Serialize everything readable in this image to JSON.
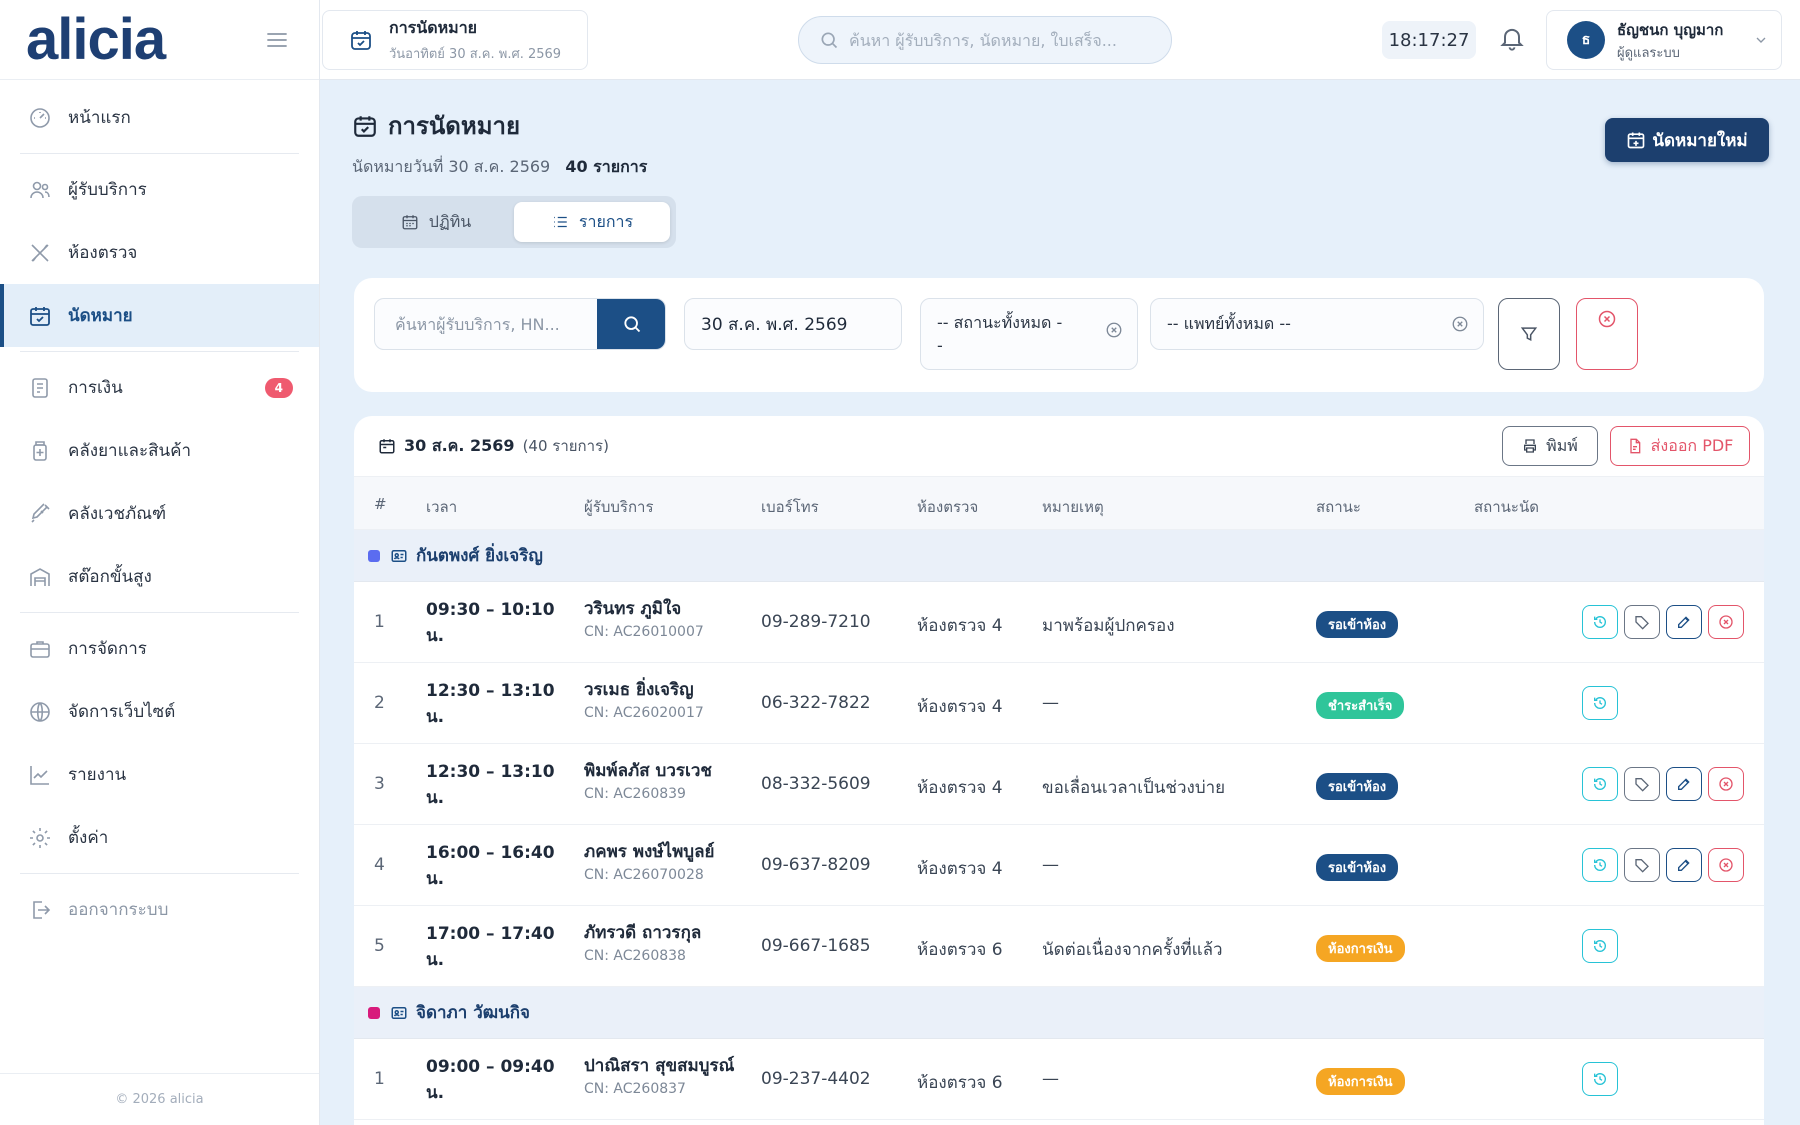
{
  "brand": {
    "logo": "alicia"
  },
  "sidebar": {
    "items": [
      {
        "label": "หน้าแรก",
        "icon": "gauge-icon"
      },
      {
        "label": "ผู้รับบริการ",
        "icon": "users-icon"
      },
      {
        "label": "ห้องตรวจ",
        "icon": "stethoscope-icon"
      },
      {
        "label": "นัดหมาย",
        "icon": "calendar-check-icon",
        "active": true
      },
      {
        "label": "การเงิน",
        "icon": "receipt-icon",
        "badge": "4"
      },
      {
        "label": "คลังยาและสินค้า",
        "icon": "medicine-icon"
      },
      {
        "label": "คลังเวชภัณฑ์",
        "icon": "syringe-icon"
      },
      {
        "label": "สต๊อกขั้นสูง",
        "icon": "warehouse-icon"
      },
      {
        "label": "การจัดการ",
        "icon": "briefcase-icon"
      },
      {
        "label": "จัดการเว็บไซต์",
        "icon": "globe-icon"
      },
      {
        "label": "รายงาน",
        "icon": "chart-line-icon"
      },
      {
        "label": "ตั้งค่า",
        "icon": "gear-icon"
      },
      {
        "label": "ออกจากระบบ",
        "icon": "logout-icon"
      }
    ],
    "footer": "© 2026 alicia"
  },
  "topbar": {
    "crumb_title": "การนัดหมาย",
    "crumb_sub": "วันอาทิตย์ 30 ส.ค. พ.ศ. 2569",
    "search_placeholder": "ค้นหา ผู้รับบริการ, นัดหมาย, ใบเสร็จ...",
    "clock": "18:17:27",
    "user_initial": "ธ",
    "user_name": "ธัญชนก บุญมาก",
    "user_role": "ผู้ดูแลระบบ"
  },
  "page": {
    "title": "การนัดหมาย",
    "subtitle": "นัดหมายวันที่ 30 ส.ค. 2569",
    "count": "40 รายการ",
    "new_button": "นัดหมายใหม่",
    "tabs": [
      {
        "label": "ปฏิทิน",
        "icon": "calendar-icon"
      },
      {
        "label": "รายการ",
        "icon": "list-icon",
        "active": true
      }
    ]
  },
  "filters": {
    "search_placeholder": "ค้นหาผู้รับบริการ, HN...",
    "date": "30 ส.ค. พ.ศ. 2569",
    "status_line1": "-- สถานะทั้งหมด -",
    "status_line2": "-",
    "doctor": "-- แพทย์ทั้งหมด --"
  },
  "table": {
    "date": "30 ส.ค. 2569",
    "count": "(40 รายการ)",
    "print_label": "พิมพ์",
    "pdf_label": "ส่งออก PDF",
    "headers": [
      "#",
      "เวลา",
      "ผู้รับบริการ",
      "เบอร์โทร",
      "ห้องตรวจ",
      "หมายเหตุ",
      "สถานะ",
      "สถานะนัด"
    ],
    "groups": [
      {
        "doctor": "กันตพงศ์ ยิ่งเจริญ",
        "color": "#5b6cf0",
        "rows": [
          {
            "idx": "1",
            "time": "09:30 – 10:10 น.",
            "name": "วรินทร ภูมิใจ",
            "cn": "CN: AC26010007",
            "phone": "09-289-7210",
            "room": "ห้องตรวจ 4",
            "note": "มาพร้อมผู้ปกครอง",
            "status": "รอเข้าห้อง",
            "status_color": "#1c4f86",
            "full_actions": true
          },
          {
            "idx": "2",
            "time": "12:30 – 13:10 น.",
            "name": "วรเมธ ยิ่งเจริญ",
            "cn": "CN: AC26020017",
            "phone": "06-322-7822",
            "room": "ห้องตรวจ 4",
            "note": "—",
            "status": "ชำระสำเร็จ",
            "status_color": "#2fc59a",
            "full_actions": false
          },
          {
            "idx": "3",
            "time": "12:30 – 13:10 น.",
            "name": "พิมพ์ลภัส บวรเวช",
            "cn": "CN: AC260839",
            "phone": "08-332-5609",
            "room": "ห้องตรวจ 4",
            "note": "ขอเลื่อนเวลาเป็นช่วงบ่าย",
            "status": "รอเข้าห้อง",
            "status_color": "#1c4f86",
            "full_actions": true
          },
          {
            "idx": "4",
            "time": "16:00 – 16:40 น.",
            "name": "ภคพร พงษ์ไพบูลย์",
            "cn": "CN: AC26070028",
            "phone": "09-637-8209",
            "room": "ห้องตรวจ 4",
            "note": "—",
            "status": "รอเข้าห้อง",
            "status_color": "#1c4f86",
            "full_actions": true
          },
          {
            "idx": "5",
            "time": "17:00 – 17:40 น.",
            "name": "ภัทรวดี ถาวรกุล",
            "cn": "CN: AC260838",
            "phone": "09-667-1685",
            "room": "ห้องตรวจ 6",
            "note": "นัดต่อเนื่องจากครั้งที่แล้ว",
            "status": "ห้องการเงิน",
            "status_color": "#f5a623",
            "full_actions": false
          }
        ]
      },
      {
        "doctor": "จิดาภา วัฒนกิจ",
        "color": "#d81b7c",
        "rows": [
          {
            "idx": "1",
            "time": "09:00 – 09:40 น.",
            "name": "ปาณิสรา สุขสมบูรณ์",
            "cn": "CN: AC260837",
            "phone": "09-237-4402",
            "room": "ห้องตรวจ 6",
            "note": "—",
            "status": "ห้องการเงิน",
            "status_color": "#f5a623",
            "full_actions": false
          }
        ]
      }
    ]
  }
}
